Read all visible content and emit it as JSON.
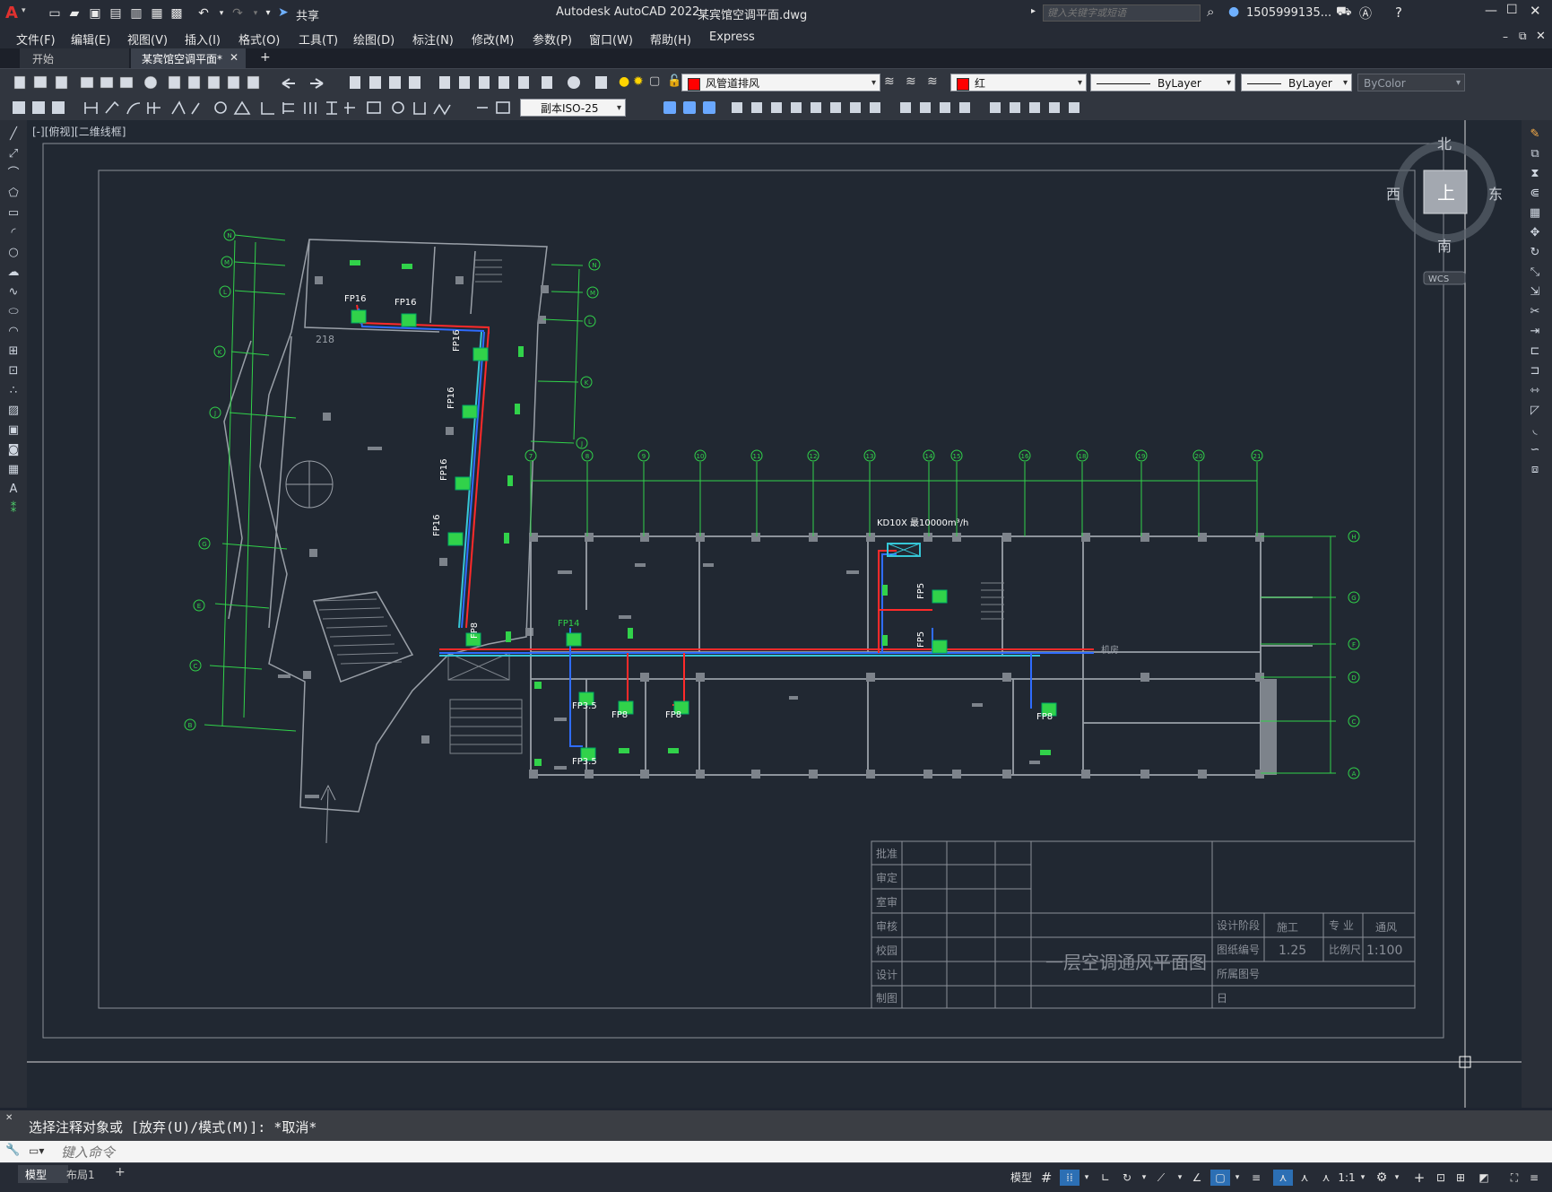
{
  "app": {
    "title": "Autodesk AutoCAD 2022",
    "filename": "某宾馆空调平面.dwg",
    "search_placeholder": "键入关键字或短语",
    "user": "1505999135...",
    "share": "共享"
  },
  "menu": [
    "文件(F)",
    "编辑(E)",
    "视图(V)",
    "插入(I)",
    "格式(O)",
    "工具(T)",
    "绘图(D)",
    "标注(N)",
    "修改(M)",
    "参数(P)",
    "窗口(W)",
    "帮助(H)",
    "Express"
  ],
  "tabs": {
    "start": "开始",
    "active": "某宾馆空调平面*",
    "add": "+"
  },
  "properties": {
    "layer": "风管道排风",
    "layer_color": "#ff0000",
    "color": "红",
    "color_swatch": "#ff0000",
    "linetype": "ByLayer",
    "lineweight": "ByLayer",
    "plotstyle": "ByColor",
    "dimstyle": "副本ISO-25"
  },
  "viewport_label": "[-][俯视][二维线框]",
  "viewcube": {
    "north": "北",
    "south": "南",
    "east": "东",
    "west": "西",
    "top": "上",
    "wcs": "WCS"
  },
  "drawing": {
    "annotation": "KD10X 最10000m³/h",
    "fan_labels": [
      "FP16",
      "FP16",
      "FP16",
      "FP16",
      "FP16",
      "FP16",
      "FP8",
      "FP14",
      "FP3.5",
      "FP8",
      "FP8",
      "FP3.5",
      "FP5",
      "FP5",
      "FP8"
    ],
    "room_218": "218",
    "room_label": "机房",
    "axis_left": [
      "N",
      "M",
      "L",
      "K",
      "J",
      "G",
      "E",
      "C",
      "B"
    ],
    "axis_right_top": [
      "N",
      "M",
      "L",
      "K",
      "J"
    ],
    "axis_top": [
      "7",
      "8",
      "9",
      "10",
      "11",
      "12",
      "13",
      "14",
      "15",
      "16",
      "18",
      "19",
      "20",
      "21"
    ],
    "axis_right": [
      "H",
      "G",
      "F",
      "D",
      "C",
      "A"
    ]
  },
  "titleblock": {
    "rows_left": [
      "批准",
      "审定",
      "室审",
      "审核",
      "校园",
      "设计",
      "制图"
    ],
    "title": "一层空调通风平面图",
    "stage_label": "设计阶段",
    "stage_value": "施工",
    "major_label": "专  业",
    "major_value": "通风",
    "drawing_no_label": "图纸编号",
    "drawing_no_value": "1.25",
    "scale_label": "比例尺",
    "scale_value": "1:100",
    "belong_label": "所属图号",
    "date_label": "日"
  },
  "command": {
    "history": "选择注释对象或 [放弃(U)/模式(M)]: *取消*",
    "placeholder": "键入命令"
  },
  "status": {
    "model_tab": "模型",
    "layout_tab": "布局1",
    "add_tab": "+",
    "model_btn": "模型",
    "scale": "1:1"
  }
}
